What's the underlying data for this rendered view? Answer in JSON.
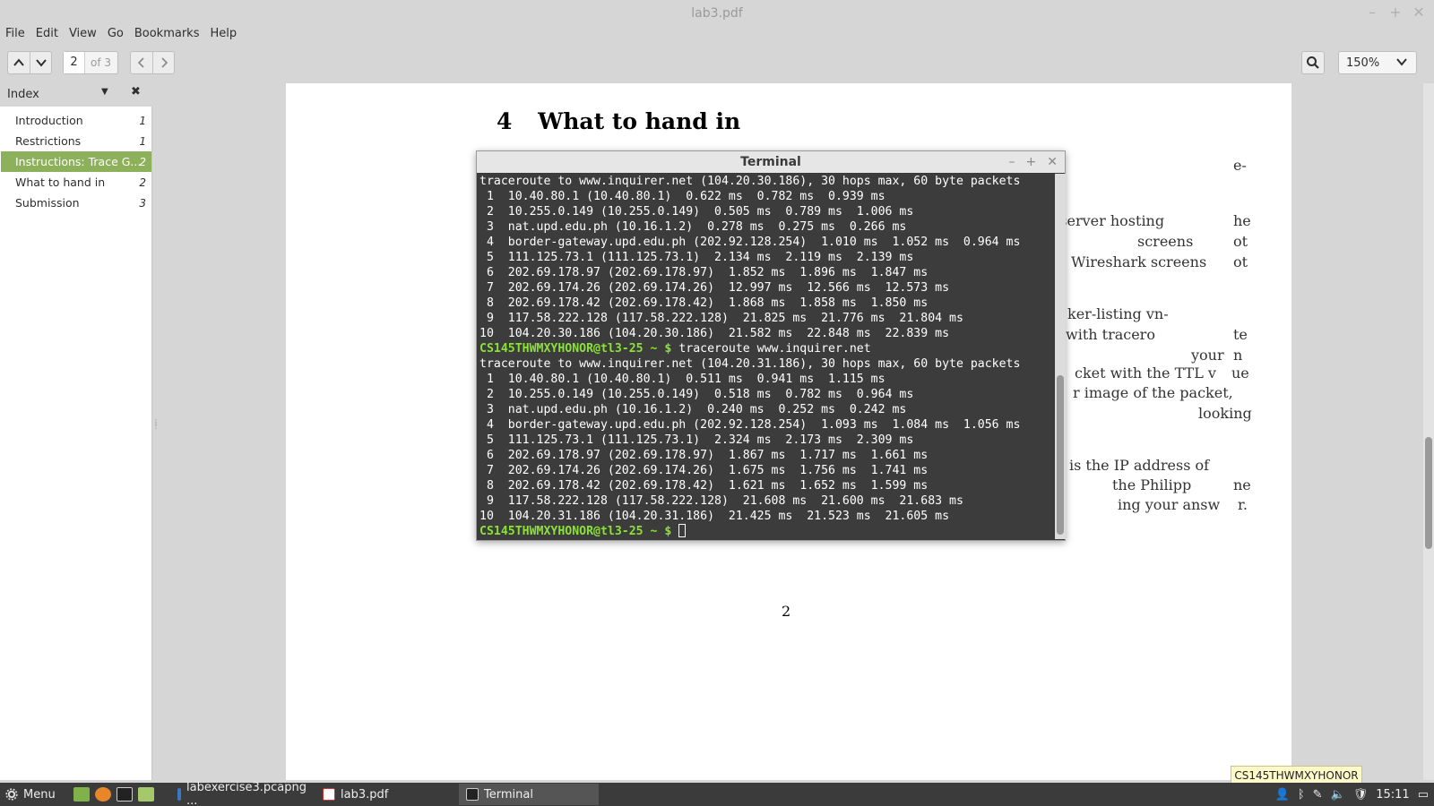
{
  "window": {
    "title": "lab3.pdf",
    "controls": [
      "–",
      "+",
      "✕"
    ]
  },
  "menubar": [
    "File",
    "Edit",
    "View",
    "Go",
    "Bookmarks",
    "Help"
  ],
  "toolbar": {
    "page_current": "2",
    "page_total": "of 3",
    "zoom": "150%"
  },
  "sidebar": {
    "title": "Index",
    "items": [
      {
        "label": "Introduction",
        "page": "1"
      },
      {
        "label": "Restrictions",
        "page": "1"
      },
      {
        "label": "Instructions: Trace G...",
        "page": "2"
      },
      {
        "label": "What to hand in",
        "page": "2"
      },
      {
        "label": "Submission",
        "page": "3"
      }
    ]
  },
  "document": {
    "section_number": "4",
    "section_title": "What to hand in",
    "visible_fragments": [
      "e-",
      "the server hosting",
      "he",
      "screens",
      "ot",
      "Wireshark screens",
      "ot",
      "ker-listing vn-",
      "with tracero",
      "te",
      "your",
      "n",
      "cket with the TTL v",
      "ue",
      "r image of the packet,",
      "looking",
      "is the IP address of",
      "the Philipp",
      "ne",
      "ing your answ",
      "r."
    ],
    "page_number": "2"
  },
  "terminal": {
    "title": "Terminal",
    "prompt": "CS145THWMXYHONOR@tl3-25 ~ $",
    "lines": [
      {
        "type": "out",
        "text": "traceroute to www.inquirer.net (104.20.30.186), 30 hops max, 60 byte packets"
      },
      {
        "type": "out",
        "text": " 1  10.40.80.1 (10.40.80.1)  0.622 ms  0.782 ms  0.939 ms"
      },
      {
        "type": "out",
        "text": " 2  10.255.0.149 (10.255.0.149)  0.505 ms  0.789 ms  1.006 ms"
      },
      {
        "type": "out",
        "text": " 3  nat.upd.edu.ph (10.16.1.2)  0.278 ms  0.275 ms  0.266 ms"
      },
      {
        "type": "out",
        "text": " 4  border-gateway.upd.edu.ph (202.92.128.254)  1.010 ms  1.052 ms  0.964 ms"
      },
      {
        "type": "out",
        "text": " 5  111.125.73.1 (111.125.73.1)  2.134 ms  2.119 ms  2.139 ms"
      },
      {
        "type": "out",
        "text": " 6  202.69.178.97 (202.69.178.97)  1.852 ms  1.896 ms  1.847 ms"
      },
      {
        "type": "out",
        "text": " 7  202.69.174.26 (202.69.174.26)  12.997 ms  12.566 ms  12.573 ms"
      },
      {
        "type": "out",
        "text": " 8  202.69.178.42 (202.69.178.42)  1.868 ms  1.858 ms  1.850 ms"
      },
      {
        "type": "out",
        "text": " 9  117.58.222.128 (117.58.222.128)  21.825 ms  21.776 ms  21.804 ms"
      },
      {
        "type": "out",
        "text": "10  104.20.30.186 (104.20.30.186)  21.582 ms  22.848 ms  22.839 ms"
      },
      {
        "type": "cmd",
        "text": " traceroute www.inquirer.net"
      },
      {
        "type": "out",
        "text": "traceroute to www.inquirer.net (104.20.31.186), 30 hops max, 60 byte packets"
      },
      {
        "type": "out",
        "text": " 1  10.40.80.1 (10.40.80.1)  0.511 ms  0.941 ms  1.115 ms"
      },
      {
        "type": "out",
        "text": " 2  10.255.0.149 (10.255.0.149)  0.518 ms  0.782 ms  0.964 ms"
      },
      {
        "type": "out",
        "text": " 3  nat.upd.edu.ph (10.16.1.2)  0.240 ms  0.252 ms  0.242 ms"
      },
      {
        "type": "out",
        "text": " 4  border-gateway.upd.edu.ph (202.92.128.254)  1.093 ms  1.084 ms  1.056 ms"
      },
      {
        "type": "out",
        "text": " 5  111.125.73.1 (111.125.73.1)  2.324 ms  2.173 ms  2.309 ms"
      },
      {
        "type": "out",
        "text": " 6  202.69.178.97 (202.69.178.97)  1.867 ms  1.717 ms  1.661 ms"
      },
      {
        "type": "out",
        "text": " 7  202.69.174.26 (202.69.174.26)  1.675 ms  1.756 ms  1.741 ms"
      },
      {
        "type": "out",
        "text": " 8  202.69.178.42 (202.69.178.42)  1.621 ms  1.652 ms  1.599 ms"
      },
      {
        "type": "out",
        "text": " 9  117.58.222.128 (117.58.222.128)  21.608 ms  21.600 ms  21.683 ms"
      },
      {
        "type": "out",
        "text": "10  104.20.31.186 (104.20.31.186)  21.425 ms  21.523 ms  21.605 ms"
      },
      {
        "type": "cmd",
        "text": " "
      }
    ],
    "colors": {
      "background": "#3c3c3c",
      "prompt": "#8ae234",
      "text": "#ffffff"
    }
  },
  "tooltip": "CS145THWMXYHONOR",
  "taskbar": {
    "menu_label": "Menu",
    "windows": [
      {
        "label": "labexercise3.pcapng ...",
        "icon": "wireshark-icon"
      },
      {
        "label": "lab3.pdf",
        "icon": "pdf-icon"
      },
      {
        "label": "Terminal",
        "icon": "terminal-icon",
        "active": true
      }
    ],
    "clock": "15:11"
  },
  "colors": {
    "sidebar_active": "#8db15a",
    "taskbar": "#3b3b3b"
  }
}
